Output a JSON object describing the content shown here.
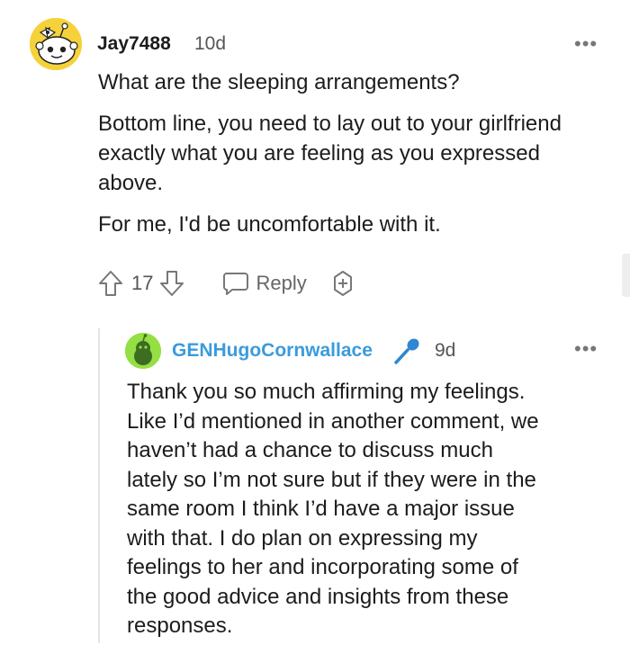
{
  "comment": {
    "username": "Jay7488",
    "time": "10d",
    "more_label": "•••",
    "paragraphs": [
      "What are the sleeping arrangements?",
      "Bottom line, you need to lay out to your girlfriend exactly what you are feeling as you expressed above.",
      "For me, I'd be uncomfortable with it."
    ],
    "vote_count": "17",
    "reply_label": "Reply",
    "icons": [
      "snoo-avatar",
      "upvote-icon",
      "downvote-icon",
      "reply-bubble-icon",
      "award-icon",
      "more-options-icon"
    ]
  },
  "reply": {
    "username": "GENHugoCornwallace",
    "username_color": "#3a9bdc",
    "flair_icon": "microphone-icon",
    "time": "9d",
    "more_label": "•••",
    "lines": [
      "Thank you so much affirming my feelings.",
      "Like I’d mentioned in another comment, we",
      "haven’t had a chance to discuss much",
      "lately so I’m not sure but if they were in the",
      "same room I think I’d have a major issue",
      "with that. I do plan on expressing my",
      "feelings to her and incorporating some of",
      "the good advice and insights from these",
      "responses."
    ]
  }
}
